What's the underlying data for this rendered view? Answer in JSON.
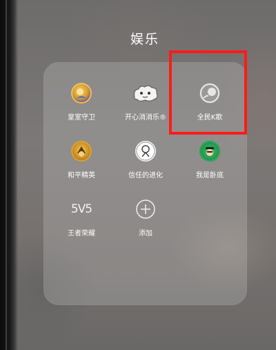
{
  "folder": {
    "title": "娱乐"
  },
  "apps": [
    {
      "label": "皇室守卫",
      "icon": "royal-guard-game-icon"
    },
    {
      "label": "开心消消乐®",
      "icon": "happy-match-game-icon"
    },
    {
      "label": "全民K歌",
      "icon": "karaoke-app-icon"
    },
    {
      "label": "和平精英",
      "icon": "peace-elite-game-icon"
    },
    {
      "label": "信任的进化",
      "icon": "evolution-of-trust-game-icon"
    },
    {
      "label": "我是卧底",
      "icon": "undercover-game-icon"
    },
    {
      "label": "王者荣耀",
      "icon": "honor-of-kings-game-icon",
      "icon_text": "5V5"
    },
    {
      "label": "添加",
      "icon": "plus-icon"
    }
  ],
  "highlight": {
    "target": "全民K歌",
    "color": "#ff1a1a"
  }
}
